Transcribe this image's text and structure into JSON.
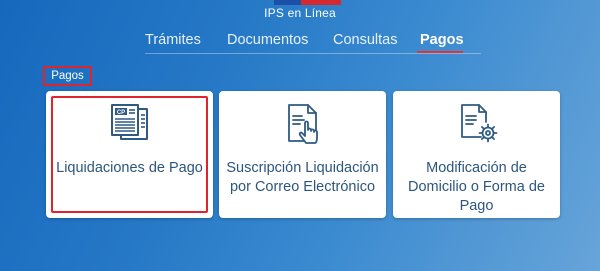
{
  "header": {
    "brand": "IPS en Línea",
    "flag_colors": [
      "#1d4fa6",
      "#d6282f"
    ]
  },
  "nav": {
    "items": [
      {
        "label": "Trámites",
        "active": false
      },
      {
        "label": "Documentos",
        "active": false
      },
      {
        "label": "Consultas",
        "active": false
      },
      {
        "label": "Pagos",
        "active": true
      }
    ],
    "active_underline_color": "#e2323a"
  },
  "breadcrumb": {
    "label": "Pagos"
  },
  "cards": [
    {
      "label": "Liquidaciones de Pago",
      "icon": "payslip-icon",
      "selected": true
    },
    {
      "label": "Suscripción Liquidación por Correo Electrónico",
      "icon": "document-touch-icon",
      "selected": false
    },
    {
      "label": "Modificación de Domicilio o Forma de Pago",
      "icon": "document-settings-icon",
      "selected": false
    }
  ],
  "colors": {
    "background": "#2679c6",
    "card_text": "#2d567d",
    "highlight": "#e0242c"
  }
}
